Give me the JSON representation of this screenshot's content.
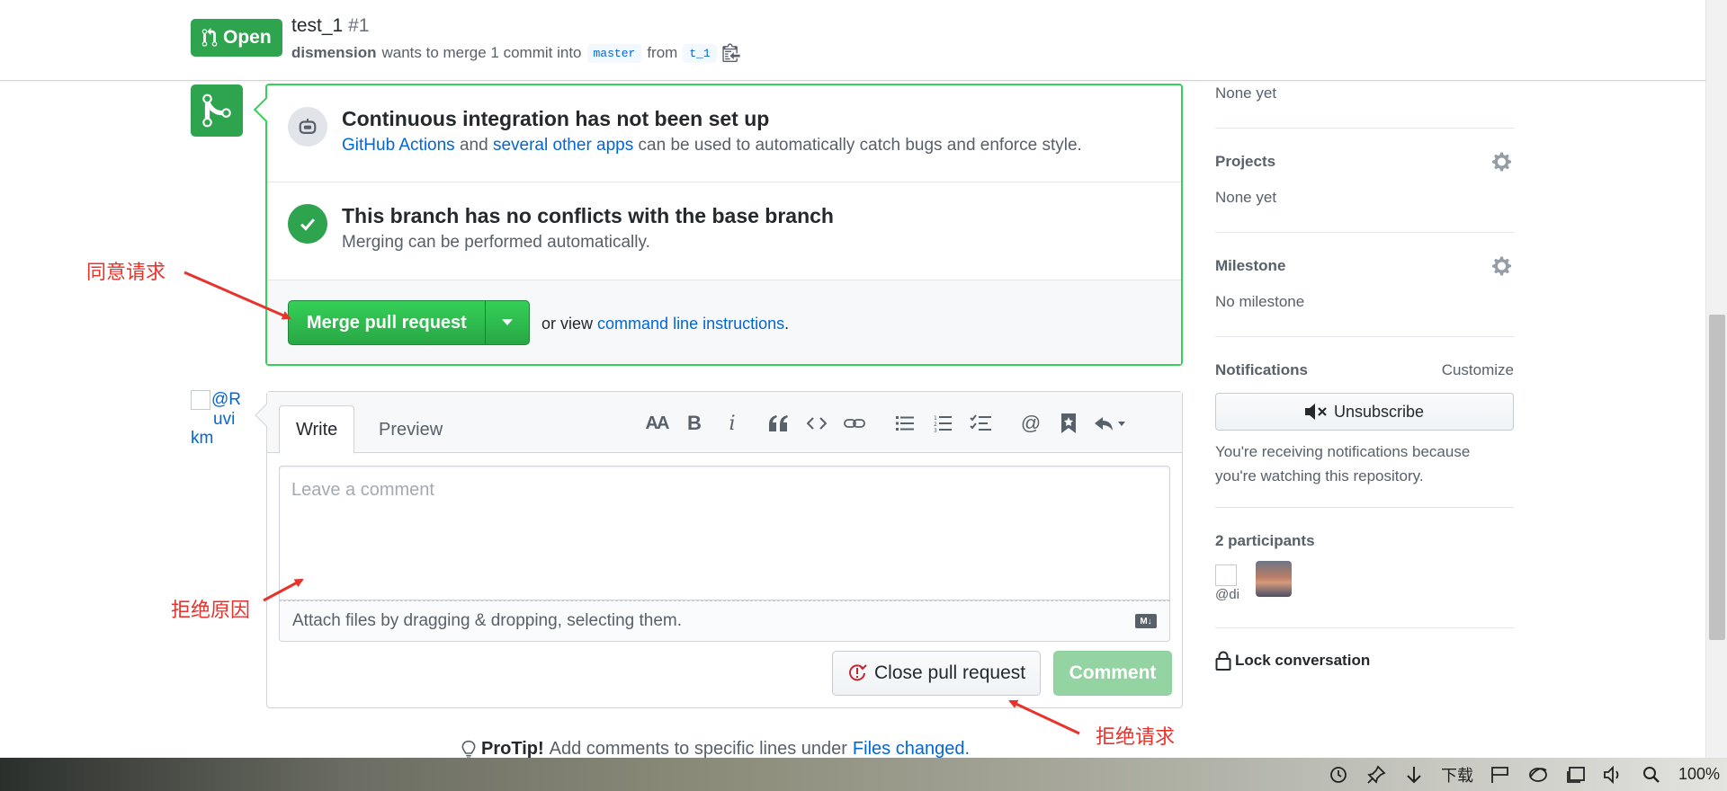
{
  "header": {
    "state": "Open",
    "title": "test_1",
    "number": "#1",
    "author": "dismension",
    "merge_text": "wants to merge 1 commit into",
    "base_branch": "master",
    "from_text": "from",
    "head_branch": "t_1"
  },
  "merge_box": {
    "ci_title": "Continuous integration has not been set up",
    "ci_link1": "GitHub Actions",
    "ci_and": "and",
    "ci_link2": "several other apps",
    "ci_rest": "can be used to automatically catch bugs and enforce style.",
    "conflict_title": "This branch has no conflicts with the base branch",
    "conflict_sub": "Merging can be performed automatically.",
    "merge_button": "Merge pull request",
    "or_view": "or view",
    "cli_link": "command line instructions",
    "period": "."
  },
  "comment": {
    "avatar_alt_line1": "@R",
    "avatar_alt_line2": "uvi",
    "avatar_alt_line3": "km",
    "tab_write": "Write",
    "tab_preview": "Preview",
    "placeholder": "Leave a comment",
    "attach_text": "Attach files by dragging & dropping, selecting them.",
    "md_badge": "M↓",
    "close_button": "Close pull request",
    "comment_button": "Comment"
  },
  "toolbar": {
    "heading": "AA",
    "bold": "B",
    "italic": "i"
  },
  "protip": {
    "label": "ProTip!",
    "text": "Add comments to specific lines under",
    "link": "Files changed",
    "period": "."
  },
  "sidebar": {
    "labels_value": "None yet",
    "projects_title": "Projects",
    "projects_value": "None yet",
    "milestone_title": "Milestone",
    "milestone_value": "No milestone",
    "notifications_title": "Notifications",
    "customize": "Customize",
    "unsubscribe": "Unsubscribe",
    "notif_reason_1": "You're receiving notifications because",
    "notif_reason_2": "you're watching this repository.",
    "participants_title": "2 participants",
    "participant_alt": "@di",
    "lock": "Lock conversation"
  },
  "annotations": {
    "approve": "同意请求",
    "reason": "拒绝原因",
    "reject": "拒绝请求"
  },
  "taskbar": {
    "download": "下载",
    "zoom": "100%"
  },
  "colors": {
    "green": "#2ea44f",
    "link": "#0366d6",
    "annotation": "#e8322c"
  }
}
